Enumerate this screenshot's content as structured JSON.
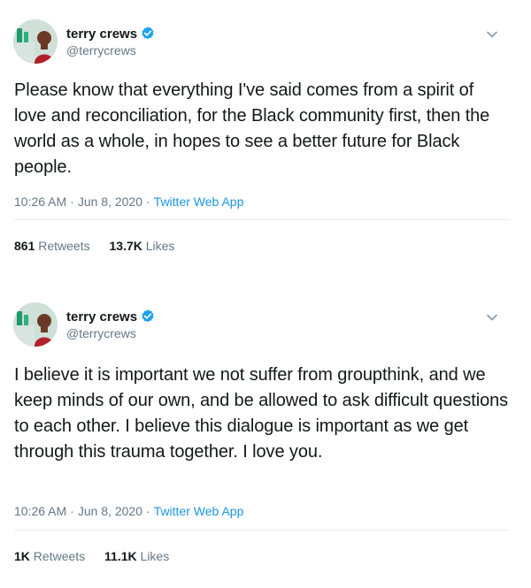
{
  "tweets": [
    {
      "author": {
        "display_name": "terry crews",
        "handle": "@terrycrews",
        "verified": true,
        "avatar_icon": "profile-photo"
      },
      "text": "Please know that everything I've said comes from a spirit of love and reconciliation, for the Black community first, then the world as a whole, in hopes to see a better future for Black people.",
      "time": "10:26 AM",
      "date": "Jun 8, 2020",
      "source": "Twitter Web App",
      "retweets_count": "861",
      "retweets_label": "Retweets",
      "likes_count": "13.7K",
      "likes_label": "Likes"
    },
    {
      "author": {
        "display_name": "terry crews",
        "handle": "@terrycrews",
        "verified": true,
        "avatar_icon": "profile-photo"
      },
      "text": "I believe it is important we not suffer from groupthink, and we keep minds of our own, and be allowed to ask difficult questions to each other. I believe this dialogue is important as we get through this trauma together. I love you.",
      "time": "10:26 AM",
      "date": "Jun 8, 2020",
      "source": "Twitter Web App",
      "retweets_count": "1K",
      "retweets_label": "Retweets",
      "likes_count": "11.1K",
      "likes_label": "Likes"
    }
  ],
  "separator": "·",
  "colors": {
    "text": "#14171a",
    "secondary": "#657786",
    "accent": "#1b95e0",
    "verified": "#1da1f2",
    "divider": "#e6ecf0"
  },
  "icons": {
    "verified": "verified-badge-icon",
    "menu": "chevron-down-icon"
  }
}
